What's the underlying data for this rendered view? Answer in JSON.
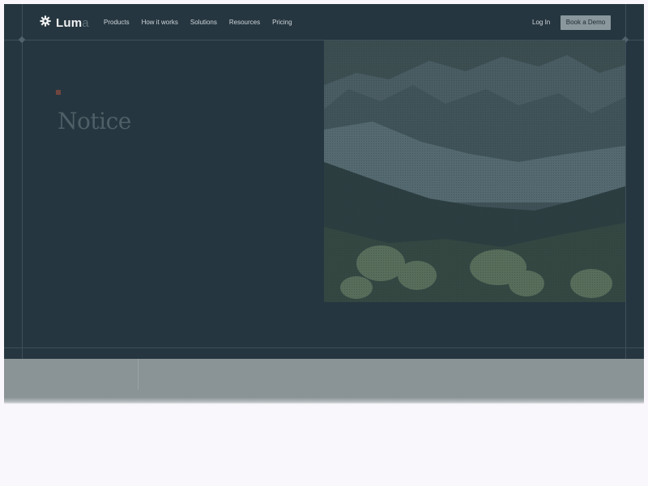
{
  "brand": {
    "name_main": "Lum",
    "name_faded": "a"
  },
  "nav": {
    "links": [
      "Products",
      "How it works",
      "Solutions",
      "Resources",
      "Pricing"
    ],
    "login_label": "Log In",
    "demo_label": "Book a Demo"
  },
  "hero": {
    "eyebrow": "",
    "heading": "Notice"
  },
  "colors": {
    "hero_bg": "#263640",
    "accent_square": "#6f463f",
    "demo_button": "#8a979c"
  },
  "icons": {
    "logo": "gear-icon"
  }
}
